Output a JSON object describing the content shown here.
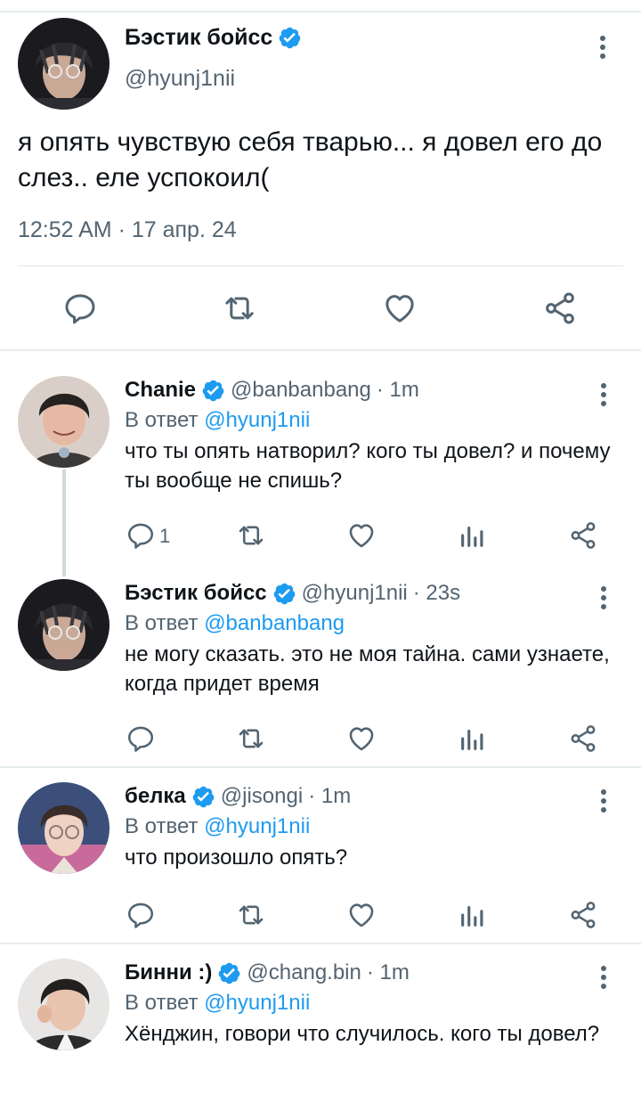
{
  "main_tweet": {
    "name": "Бэстик бойсс",
    "handle": "@hyunj1nii",
    "text": "я опять чувствую себя тварью... я довел его до слез.. еле успокоил(",
    "timestamp": "12:52 AM · 17 апр. 24"
  },
  "replies": [
    {
      "name": "Chanie",
      "handle": "@banbanbang",
      "time": "· 1m",
      "reply_prefix": "В ответ",
      "reply_to": "@hyunj1nii",
      "text": "что ты опять натворил? кого ты довел? и почему ты вообще не спишь?",
      "reply_count": "1"
    },
    {
      "name": "Бэстик бойсс",
      "handle": "@hyunj1nii",
      "time": "· 23s",
      "reply_prefix": "В ответ",
      "reply_to": "@banbanbang",
      "text": "не могу сказать. это не моя тайна. сами узнаете, когда придет время",
      "reply_count": ""
    },
    {
      "name": "белка",
      "handle": "@jisongi",
      "time": "· 1m",
      "reply_prefix": "В ответ",
      "reply_to": "@hyunj1nii",
      "text": "что произошло опять?",
      "reply_count": ""
    },
    {
      "name": "Бинни :)",
      "handle": "@chang.bin",
      "time": "· 1m",
      "reply_prefix": "В ответ",
      "reply_to": "@hyunj1nii",
      "text": "Хёнджин, говори что случилось. кого ты довел?",
      "reply_count": ""
    }
  ],
  "icons": {
    "reply": "reply-icon",
    "retweet": "retweet-icon",
    "like": "heart-icon",
    "views": "views-icon",
    "share": "share-icon",
    "more": "more-vertical-icon",
    "verified": "verified-badge-icon"
  },
  "colors": {
    "accent": "#1d9bf0",
    "text": "#0f1419",
    "muted": "#536471",
    "divider": "#e6ecf0"
  }
}
